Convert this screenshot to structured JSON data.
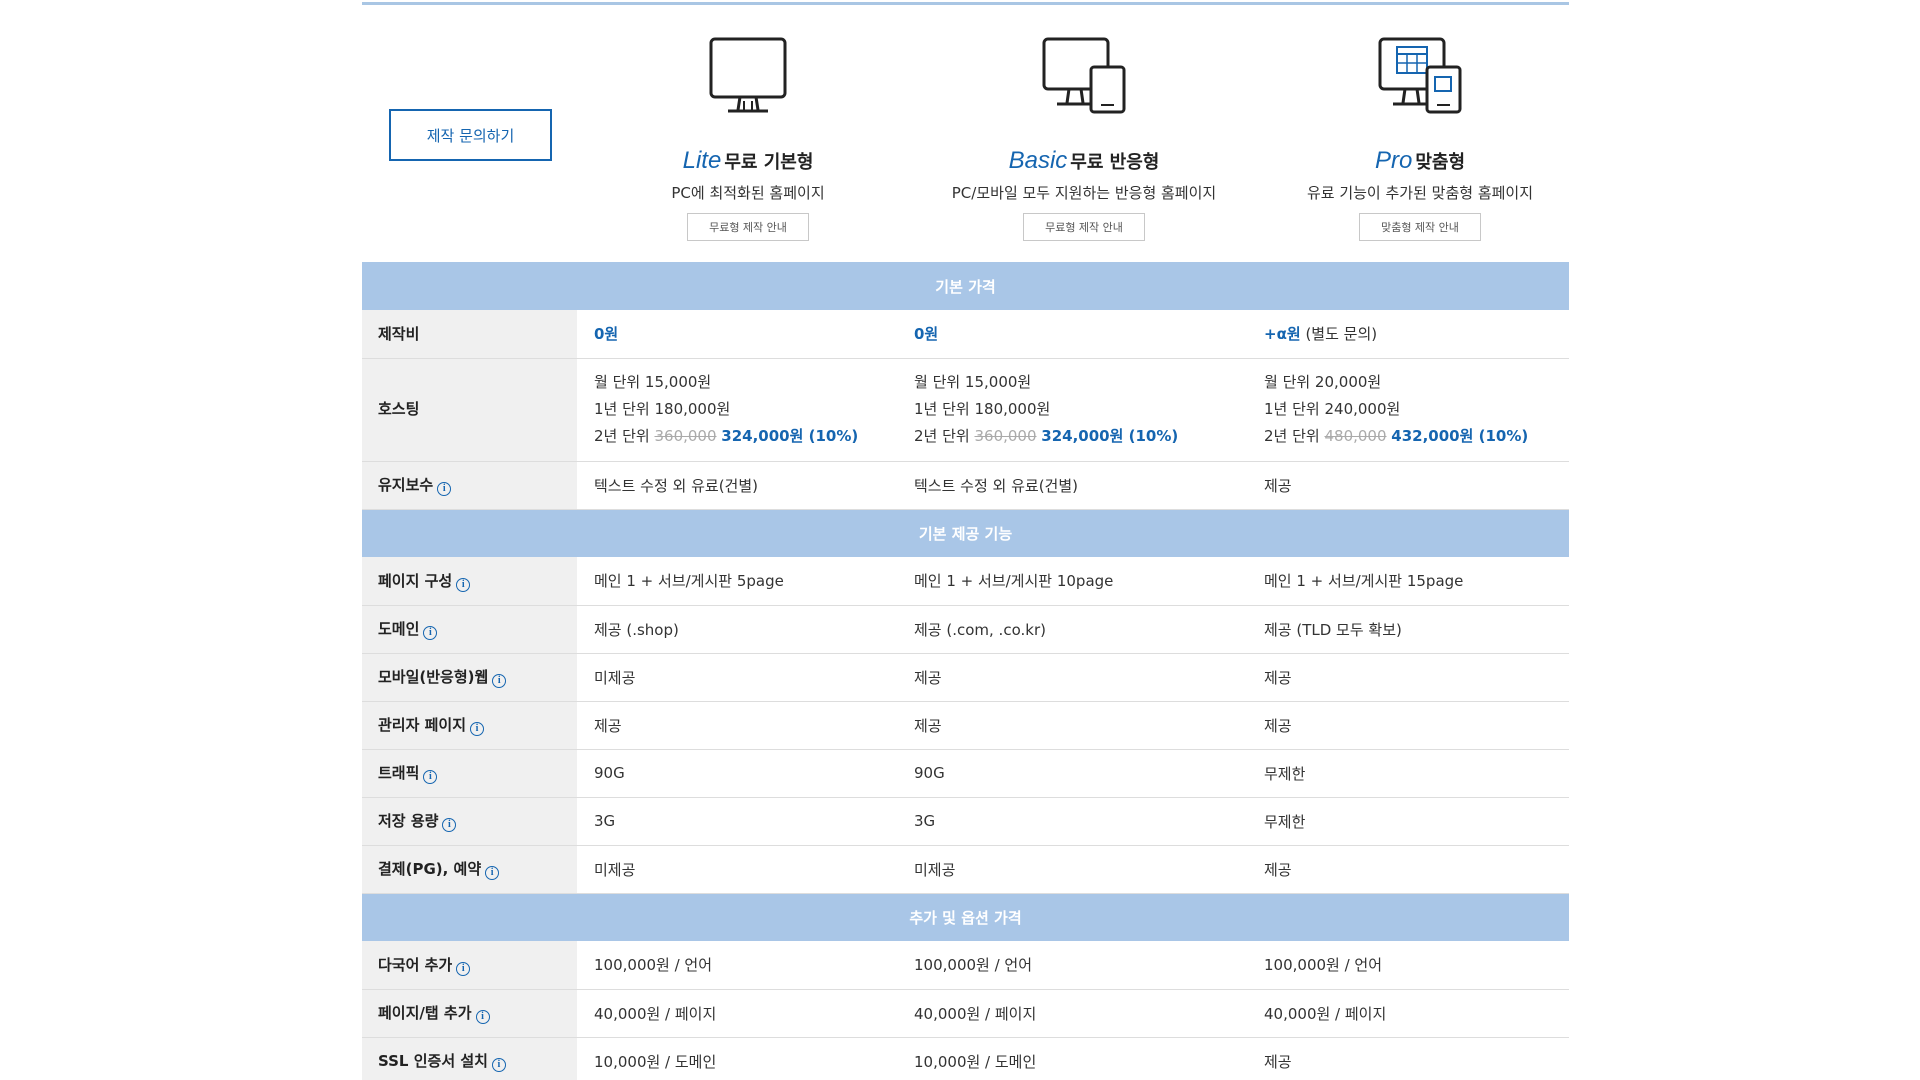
{
  "colors": {
    "accent": "#1565b0",
    "section_bg": "#a9c6e7",
    "label_bg": "#f0f0f0"
  },
  "inquiry_button": "제작 문의하기",
  "plans": [
    {
      "name_en": "Lite",
      "name_ko": "무료 기본형",
      "desc": "PC에 최적화된 홈페이지",
      "guide": "무료형 제작 안내",
      "icon": "monitor-icon"
    },
    {
      "name_en": "Basic",
      "name_ko": "무료 반응형",
      "desc": "PC/모바일 모두 지원하는 반응형 홈페이지",
      "guide": "무료형 제작 안내",
      "icon": "monitor-mobile-icon"
    },
    {
      "name_en": "Pro",
      "name_ko": "맞춤형",
      "desc": "유료 기능이 추가된 맞춤형 홈페이지",
      "guide": "맞춤형 제작 안내",
      "icon": "custom-device-icon"
    }
  ],
  "sections": {
    "basic_price": "기본 가격",
    "basic_features": "기본 제공 기능",
    "options": "추가 및 옵션 가격"
  },
  "pricing": {
    "production": {
      "label": "제작비",
      "values": [
        "0원",
        "0원",
        "+α원"
      ],
      "pro_note": " (별도 문의)"
    },
    "hosting": {
      "label": "호스팅",
      "monthly": [
        "월 단위 15,000원",
        "월 단위 15,000원",
        "월 단위 20,000원"
      ],
      "yearly": [
        "1년 단위 180,000원",
        "1년 단위 180,000원",
        "1년 단위 240,000원"
      ],
      "two_year_prefix": "2년 단위 ",
      "two_year_old": [
        "360,000",
        "360,000",
        "480,000"
      ],
      "two_year_new": [
        "324,000원 (10%)",
        "324,000원 (10%)",
        "432,000원 (10%)"
      ]
    },
    "maintenance": {
      "label": "유지보수",
      "values": [
        "텍스트 수정 외 유료(건별)",
        "텍스트 수정 외 유료(건별)",
        "제공"
      ]
    }
  },
  "features": [
    {
      "label": "페이지 구성",
      "values": [
        "메인 1 + 서브/게시판 5page",
        "메인 1 + 서브/게시판 10page",
        "메인 1 + 서브/게시판 15page"
      ]
    },
    {
      "label": "도메인",
      "values": [
        "제공 (.shop)",
        "제공 (.com, .co.kr)",
        "제공 (TLD 모두 확보)"
      ]
    },
    {
      "label": "모바일(반응형)웹",
      "values": [
        "미제공",
        "제공",
        "제공"
      ]
    },
    {
      "label": "관리자 페이지",
      "values": [
        "제공",
        "제공",
        "제공"
      ]
    },
    {
      "label": "트래픽",
      "values": [
        "90G",
        "90G",
        "무제한"
      ]
    },
    {
      "label": "저장 용량",
      "values": [
        "3G",
        "3G",
        "무제한"
      ]
    },
    {
      "label": "결제(PG), 예약",
      "values": [
        "미제공",
        "미제공",
        "제공"
      ]
    }
  ],
  "options": [
    {
      "label": "다국어 추가",
      "values": [
        "100,000원 / 언어",
        "100,000원 / 언어",
        "100,000원 / 언어"
      ]
    },
    {
      "label": "페이지/탭 추가",
      "values": [
        "40,000원 / 페이지",
        "40,000원 / 페이지",
        "40,000원 / 페이지"
      ]
    },
    {
      "label": "SSL 인증서 설치",
      "values": [
        "10,000원 / 도메인",
        "10,000원 / 도메인",
        "제공"
      ]
    }
  ]
}
